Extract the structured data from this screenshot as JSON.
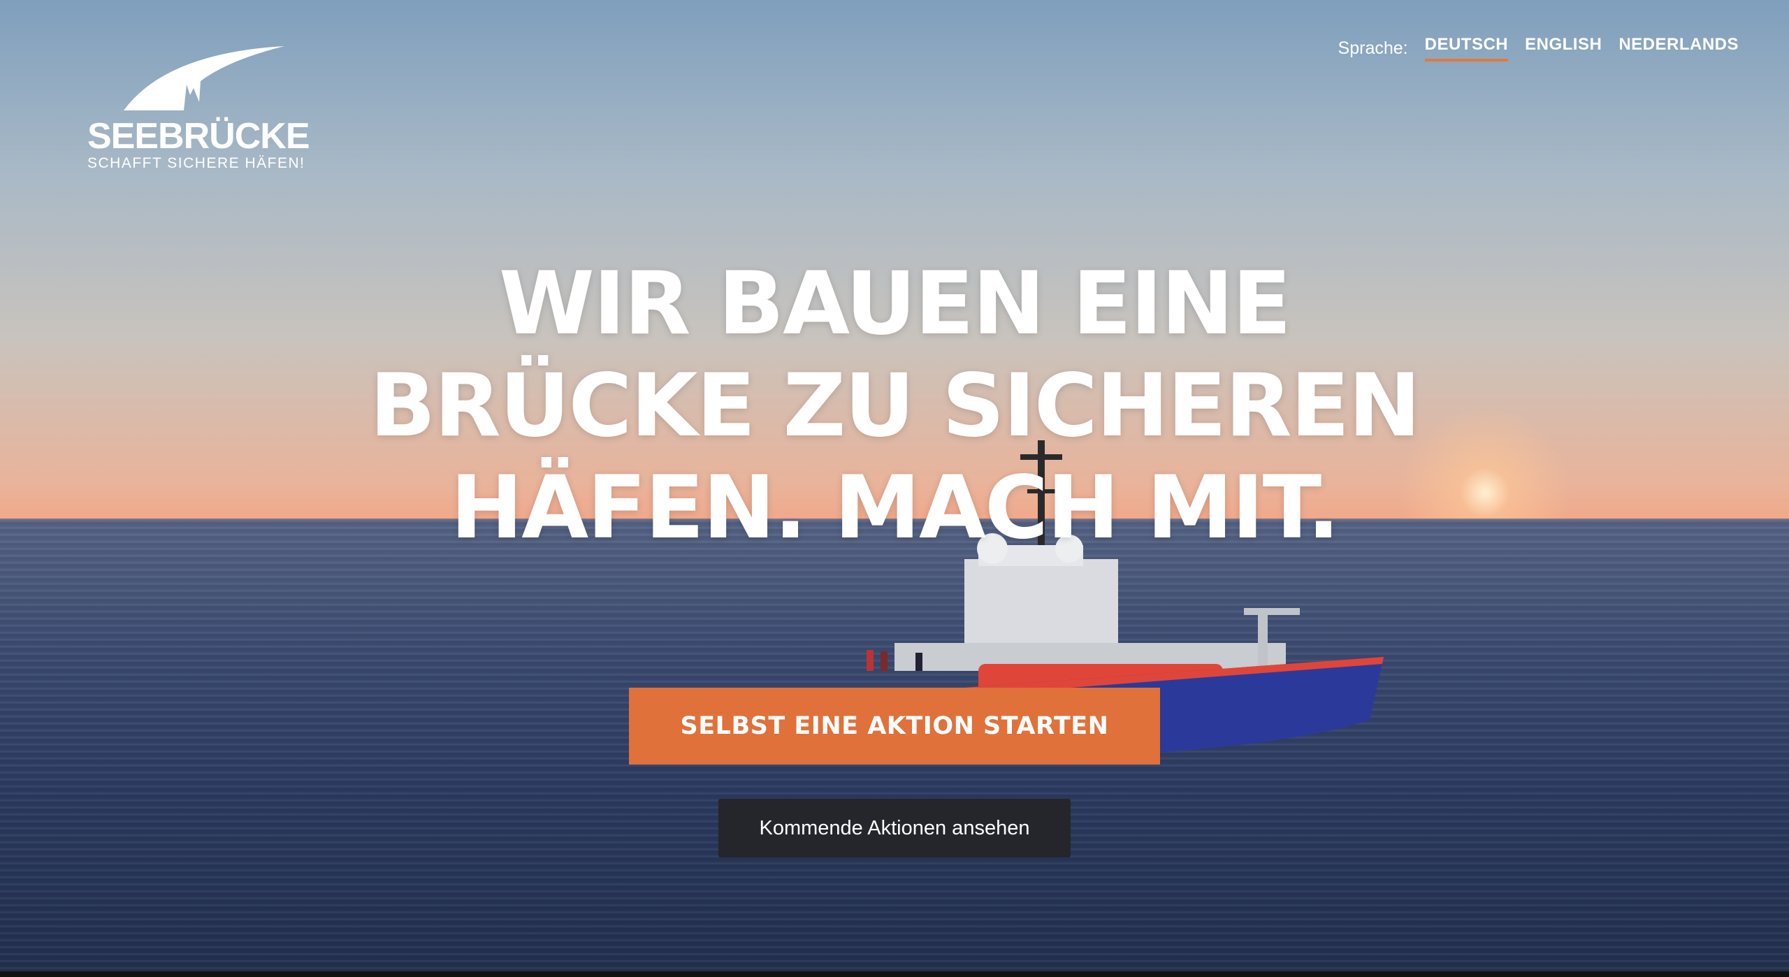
{
  "logo": {
    "title": "SEEBRÜCKE",
    "subtitle": "SCHAFFT SICHERE HÄFEN!"
  },
  "language_nav": {
    "label": "Sprache:",
    "options": [
      {
        "label": "DEUTSCH",
        "active": true
      },
      {
        "label": "ENGLISH",
        "active": false
      },
      {
        "label": "NEDERLANDS",
        "active": false
      }
    ]
  },
  "hero": {
    "headline_lines": [
      "WIR BAUEN EINE",
      "BRÜCKE ZU SICHEREN",
      "HÄFEN. MACH MIT."
    ],
    "primary_button": "SELBST EINE AKTION STARTEN",
    "secondary_button": "Kommende Aktionen ansehen"
  },
  "colors": {
    "accent": "#e0713a",
    "active_underline": "#e07a3c",
    "secondary_button_bg": "#25262b"
  }
}
